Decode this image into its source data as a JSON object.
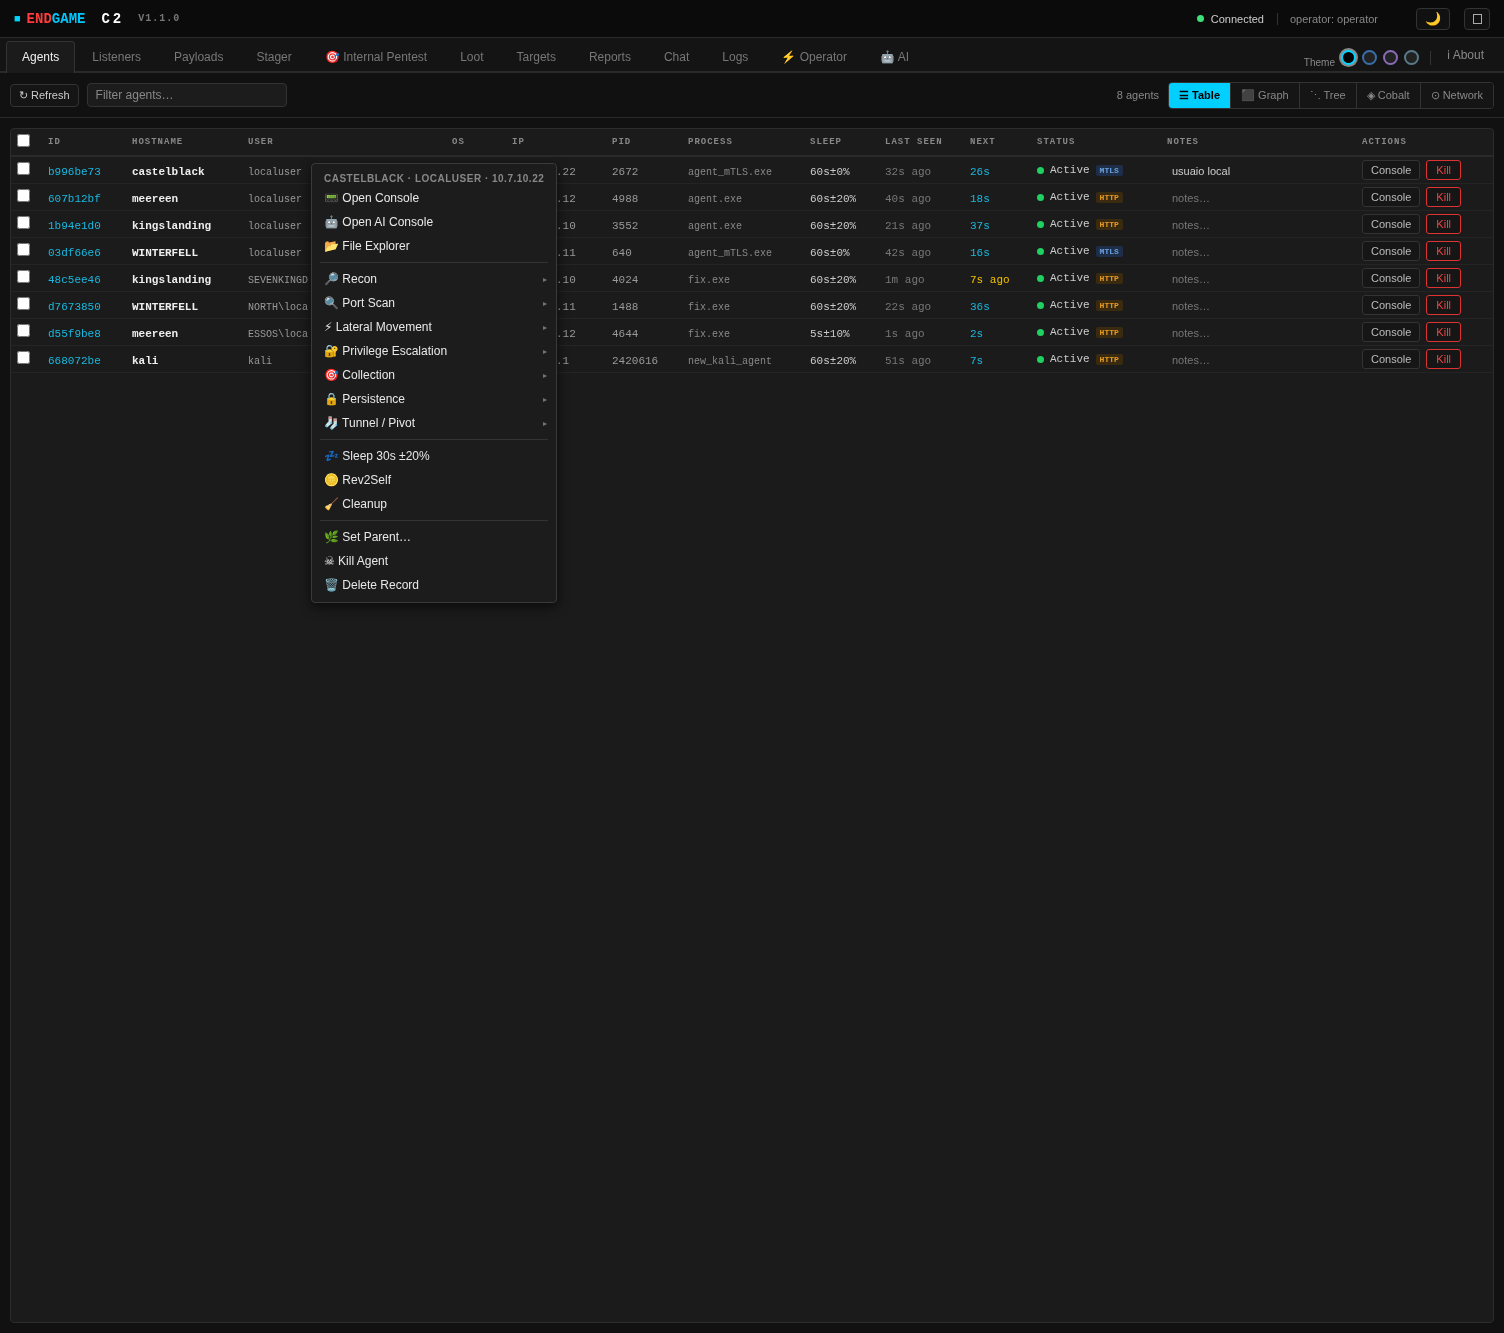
{
  "header": {
    "logo_mark": "■",
    "logo_a": "END",
    "logo_b": "GAME",
    "logo_c": "C2",
    "version": "V1.1.0",
    "connection": {
      "label": "Connected",
      "connected": true
    },
    "operator": "operator: operator",
    "moon": "🌙"
  },
  "tabs": [
    {
      "label": "Agents",
      "selected": true
    },
    {
      "label": "Listeners",
      "selected": false
    },
    {
      "label": "Payloads",
      "selected": false
    },
    {
      "label": "Stager",
      "selected": false
    },
    {
      "label": "🎯 Internal Pentest",
      "selected": false
    },
    {
      "label": "Loot",
      "selected": false
    },
    {
      "label": "Targets",
      "selected": false
    },
    {
      "label": "Reports",
      "selected": false
    },
    {
      "label": "Chat",
      "selected": false
    },
    {
      "label": "Logs",
      "selected": false
    },
    {
      "label": "⚡ Operator",
      "selected": false
    },
    {
      "label": "🤖 AI",
      "selected": false
    }
  ],
  "theme": {
    "label": "Theme",
    "swatches": [
      {
        "color": "#00d4ff",
        "selected": true
      },
      {
        "color": "#3a6ea8",
        "selected": false
      },
      {
        "color": "#8a6bb8",
        "selected": false
      },
      {
        "color": "#5a7a8a",
        "selected": false
      }
    ]
  },
  "about": "ℹ About",
  "toolbar": {
    "refresh": "↻ Refresh",
    "filter": {
      "placeholder": "Filter agents…"
    },
    "count": "8 agents",
    "views": [
      {
        "label": "☰ Table",
        "selected": true
      },
      {
        "label": "⬛ Graph",
        "selected": false
      },
      {
        "label": "⋱ Tree",
        "selected": false
      },
      {
        "label": "◈ Cobalt",
        "selected": false
      },
      {
        "label": "⊙ Network",
        "selected": false
      }
    ]
  },
  "table": {
    "all_checked": false,
    "columns": [
      "ID",
      "HOSTNAME",
      "USER",
      "OS",
      "IP",
      "PID",
      "PROCESS",
      "SLEEP",
      "LAST SEEN",
      "NEXT",
      "STATUS",
      "NOTES",
      "ACTIONS"
    ],
    "rows": [
      {
        "checked": false,
        "id": "b996be73",
        "hostname": "castelblack",
        "user": "localuser",
        "ip": ".22",
        "pid": "2672",
        "process": "agent_mTLS.exe",
        "sleep": "60s±0%",
        "last_seen": "32s ago",
        "next": "26s",
        "overdue": false,
        "status": "Active",
        "transport": {
          "label": "MTLS",
          "kind": "mtls"
        },
        "notes": {
          "value": "usuaio local"
        },
        "console": "Console",
        "kill": "Kill"
      },
      {
        "checked": false,
        "id": "607b12bf",
        "hostname": "meereen",
        "user": "localuser",
        "ip": ".12",
        "pid": "4988",
        "process": "agent.exe",
        "sleep": "60s±20%",
        "last_seen": "40s ago",
        "next": "18s",
        "overdue": false,
        "status": "Active",
        "transport": {
          "label": "HTTP",
          "kind": "http"
        },
        "notes": {
          "placeholder": "notes…"
        },
        "console": "Console",
        "kill": "Kill"
      },
      {
        "checked": false,
        "id": "1b94e1d0",
        "hostname": "kingslanding",
        "user": "localuser",
        "ip": ".10",
        "pid": "3552",
        "process": "agent.exe",
        "sleep": "60s±20%",
        "last_seen": "21s ago",
        "next": "37s",
        "overdue": false,
        "status": "Active",
        "transport": {
          "label": "HTTP",
          "kind": "http"
        },
        "notes": {
          "placeholder": "notes…"
        },
        "console": "Console",
        "kill": "Kill"
      },
      {
        "checked": false,
        "id": "03df66e6",
        "hostname": "WINTERFELL",
        "user": "localuser",
        "ip": ".11",
        "pid": "640",
        "process": "agent_mTLS.exe",
        "sleep": "60s±0%",
        "last_seen": "42s ago",
        "next": "16s",
        "overdue": false,
        "status": "Active",
        "transport": {
          "label": "MTLS",
          "kind": "mtls"
        },
        "notes": {
          "placeholder": "notes…"
        },
        "console": "Console",
        "kill": "Kill"
      },
      {
        "checked": false,
        "id": "48c5ee46",
        "hostname": "kingslanding",
        "user": "SEVENKINGD",
        "ip": ".10",
        "pid": "4024",
        "process": "fix.exe",
        "sleep": "60s±20%",
        "last_seen": "1m ago",
        "next": "7s ago",
        "overdue": true,
        "status": "Active",
        "transport": {
          "label": "HTTP",
          "kind": "http"
        },
        "notes": {
          "placeholder": "notes…"
        },
        "console": "Console",
        "kill": "Kill"
      },
      {
        "checked": false,
        "id": "d7673850",
        "hostname": "WINTERFELL",
        "user": "NORTH\\loca",
        "ip": ".11",
        "pid": "1488",
        "process": "fix.exe",
        "sleep": "60s±20%",
        "last_seen": "22s ago",
        "next": "36s",
        "overdue": false,
        "status": "Active",
        "transport": {
          "label": "HTTP",
          "kind": "http"
        },
        "notes": {
          "placeholder": "notes…"
        },
        "console": "Console",
        "kill": "Kill"
      },
      {
        "checked": false,
        "id": "d55f9be8",
        "hostname": "meereen",
        "user": "ESSOS\\loca",
        "ip": ".12",
        "pid": "4644",
        "process": "fix.exe",
        "sleep": "5s±10%",
        "last_seen": "1s ago",
        "next": "2s",
        "overdue": false,
        "status": "Active",
        "transport": {
          "label": "HTTP",
          "kind": "http"
        },
        "notes": {
          "placeholder": "notes…"
        },
        "console": "Console",
        "kill": "Kill"
      },
      {
        "checked": false,
        "id": "668072be",
        "hostname": "kali",
        "user": "kali",
        "ip": ".1",
        "pid": "2420616",
        "process": "new_kali_agent",
        "sleep": "60s±20%",
        "last_seen": "51s ago",
        "next": "7s",
        "overdue": false,
        "status": "Active",
        "transport": {
          "label": "HTTP",
          "kind": "http"
        },
        "notes": {
          "placeholder": "notes…"
        },
        "console": "Console",
        "kill": "Kill"
      }
    ]
  },
  "context_menu": {
    "title": "CASTELBLACK · LOCALUSER · 10.7.10.22",
    "groups": [
      [
        {
          "label": "📟 Open Console",
          "submenu": false
        },
        {
          "label": "🤖 Open AI Console",
          "submenu": false
        },
        {
          "label": "📂 File Explorer",
          "submenu": false
        }
      ],
      [
        {
          "label": "🔎 Recon",
          "submenu": true
        },
        {
          "label": "🔍 Port Scan",
          "submenu": true
        },
        {
          "label": "⚡ Lateral Movement",
          "submenu": true
        },
        {
          "label": "🔐 Privilege Escalation",
          "submenu": true
        },
        {
          "label": "🎯 Collection",
          "submenu": true
        },
        {
          "label": "🔒 Persistence",
          "submenu": true
        },
        {
          "label": "🧦 Tunnel / Pivot",
          "submenu": true
        }
      ],
      [
        {
          "label": "💤 Sleep 30s ±20%",
          "submenu": false
        },
        {
          "label": "🪙 Rev2Self",
          "submenu": false
        },
        {
          "label": "🧹 Cleanup",
          "submenu": false
        }
      ],
      [
        {
          "label": "🌿 Set Parent…",
          "submenu": false
        },
        {
          "label": "☠ Kill Agent",
          "submenu": false
        },
        {
          "label": "🗑️ Delete Record",
          "submenu": false
        }
      ]
    ],
    "submenu_mark": "▸"
  }
}
